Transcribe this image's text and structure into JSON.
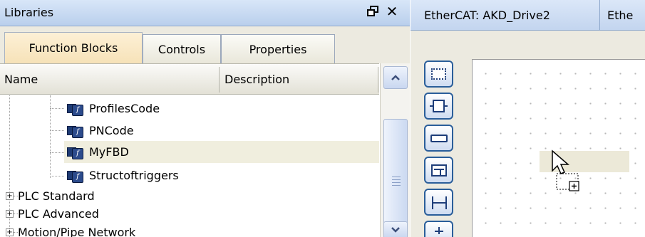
{
  "libraries": {
    "title": "Libraries",
    "tabs": [
      {
        "label": "Function Blocks",
        "active": true
      },
      {
        "label": "Controls",
        "active": false
      },
      {
        "label": "Properties",
        "active": false
      }
    ],
    "columns": {
      "name": "Name",
      "description": "Description"
    },
    "tree": [
      {
        "label": "ProfilesCode",
        "icon": "function-block-icon"
      },
      {
        "label": "PNCode",
        "icon": "function-block-icon"
      },
      {
        "label": "MyFBD",
        "icon": "function-block-icon",
        "selected": true
      },
      {
        "label": "Structoftriggers",
        "icon": "function-block-icon"
      },
      {
        "label": "PLC Standard",
        "expander": "+"
      },
      {
        "label": "PLC Advanced",
        "expander": "+"
      },
      {
        "label": "Motion/Pipe Network",
        "expander": "+"
      }
    ]
  },
  "editor": {
    "tabs": [
      {
        "label": "EtherCAT: AKD_Drive2"
      },
      {
        "label": "Ethe"
      }
    ],
    "toolbar": [
      "selection-tool-icon",
      "function-block-tool-icon",
      "input-tool-icon",
      "block-table-tool-icon",
      "connector-tool-icon",
      "terminal-tool-icon"
    ]
  },
  "colors": {
    "selection": "#f0eede",
    "panel_bg": "#eceae0",
    "active_tab": "#f6e2b8",
    "title_bar": "#c3d5ef"
  }
}
